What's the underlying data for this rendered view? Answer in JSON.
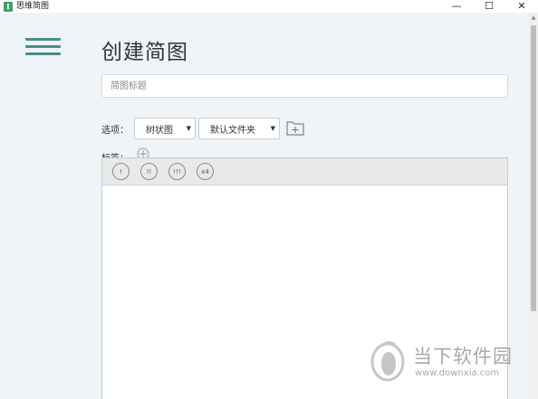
{
  "window": {
    "title": "思维简图",
    "minimize_glyph": "—",
    "maximize_glyph": "☐",
    "close_glyph": "✕"
  },
  "page": {
    "title": "创建简图"
  },
  "form": {
    "title_placeholder": "简图标题",
    "options_label": "选项：",
    "diagram_type": "树状图",
    "folder": "默认文件夹",
    "tags_label": "标签："
  },
  "toolbar": {
    "buttons": [
      {
        "icon": "priority-1-icon",
        "label": "!"
      },
      {
        "icon": "priority-2-icon",
        "label": "!!"
      },
      {
        "icon": "priority-3-icon",
        "label": "!!!"
      },
      {
        "icon": "priority-x4-icon",
        "label": "x4"
      }
    ]
  },
  "watermark": {
    "text": "当下软件园",
    "url": "www.downxia.com"
  },
  "colors": {
    "accent": "#4a8c87",
    "background": "#eef4f8",
    "toolbar_bg": "#e9e9e9"
  }
}
